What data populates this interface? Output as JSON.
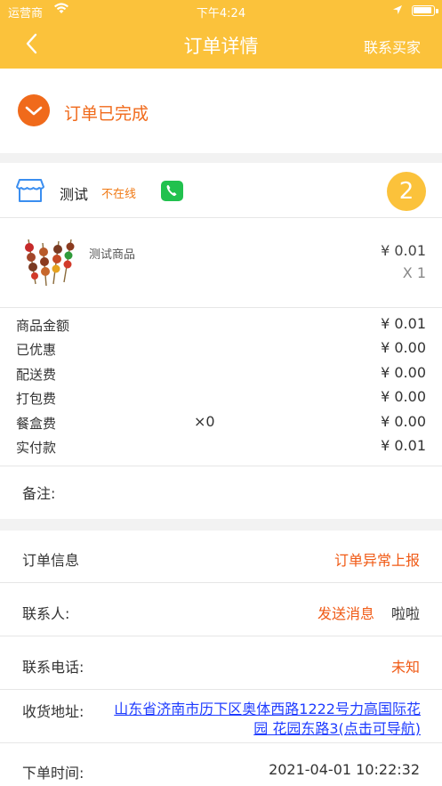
{
  "status_bar": {
    "carrier": "运营商",
    "time": "下午4:24"
  },
  "nav": {
    "title": "订单详情",
    "action": "联系买家"
  },
  "order_status": {
    "text": "订单已完成"
  },
  "shop": {
    "name": "测试",
    "online_state": "不在线",
    "badge": "2"
  },
  "product": {
    "name": "测试商品",
    "price": "¥ 0.01",
    "quantity": "X 1"
  },
  "fees": [
    {
      "label": "商品金额",
      "value": "¥ 0.01",
      "mid": ""
    },
    {
      "label": "已优惠",
      "value": "¥ 0.00",
      "mid": ""
    },
    {
      "label": "配送费",
      "value": "¥ 0.00",
      "mid": ""
    },
    {
      "label": "打包费",
      "value": "¥ 0.00",
      "mid": ""
    },
    {
      "label": "餐盒费",
      "value": "¥ 0.00",
      "mid": "×0"
    },
    {
      "label": "实付款",
      "value": "¥ 0.01",
      "mid": ""
    }
  ],
  "remark_label": "备注:",
  "info": {
    "order_info_label": "订单信息",
    "report_link": "订单异常上报",
    "contact_label": "联系人:",
    "send_message": "发送消息",
    "contact_name": "啦啦",
    "phone_label": "联系电话:",
    "phone_value": "未知",
    "address_label": "收货地址:",
    "address_value": "山东省济南市历下区奥体西路1222号力高国际花园 花园东路3(点击可导航)",
    "time_label": "下单时间:",
    "time_value": "2021-04-01 10:22:32"
  },
  "colors": {
    "header": "#fbc23b",
    "accent": "#f06a1b",
    "link": "#1f3cff",
    "phone": "#21c14e"
  }
}
